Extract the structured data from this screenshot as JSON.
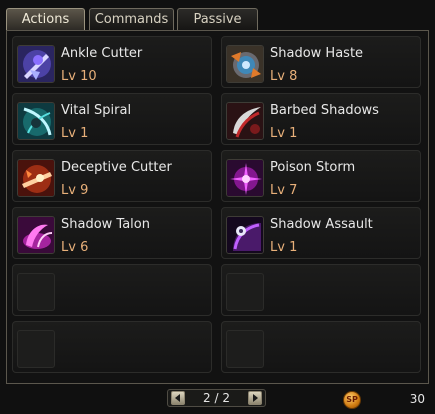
{
  "tabs": [
    {
      "label": "Actions",
      "active": true
    },
    {
      "label": "Commands",
      "active": false
    },
    {
      "label": "Passive",
      "active": false
    }
  ],
  "skills": [
    {
      "name": "Ankle Cutter",
      "level": "Lv 10",
      "icon": "ankle-cutter-icon"
    },
    {
      "name": "Shadow Haste",
      "level": "Lv 8",
      "icon": "shadow-haste-icon"
    },
    {
      "name": "Vital Spiral",
      "level": "Lv 1",
      "icon": "vital-spiral-icon"
    },
    {
      "name": "Barbed Shadows",
      "level": "Lv 1",
      "icon": "barbed-shadows-icon"
    },
    {
      "name": "Deceptive Cutter",
      "level": "Lv 9",
      "icon": "deceptive-cutter-icon"
    },
    {
      "name": "Poison Storm",
      "level": "Lv 7",
      "icon": "poison-storm-icon"
    },
    {
      "name": "Shadow Talon",
      "level": "Lv 6",
      "icon": "shadow-talon-icon"
    },
    {
      "name": "Shadow Assault",
      "level": "Lv 1",
      "icon": "shadow-assault-icon"
    }
  ],
  "empty_slots": 4,
  "pager": {
    "text": "2 / 2",
    "prev_icon": "triangle-left-icon",
    "next_icon": "triangle-right-icon"
  },
  "sp": {
    "badge": "SP",
    "value": "30"
  },
  "colors": {
    "level_text": "#e8b07a",
    "skill_name": "#e8e8e8",
    "sp_badge": "#e8941e"
  }
}
